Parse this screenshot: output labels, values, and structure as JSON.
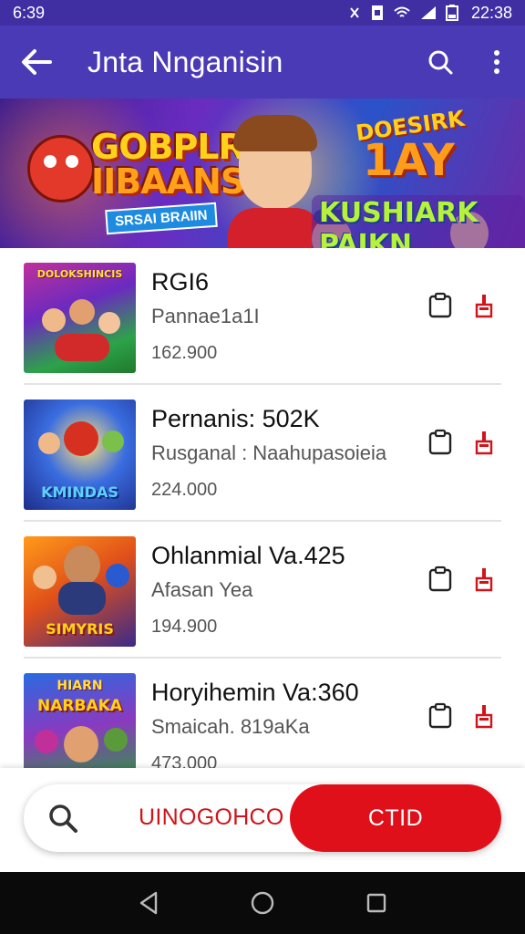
{
  "status_bar": {
    "time_left": "6:39",
    "time_right": "22:38"
  },
  "app_bar": {
    "title": "Jnta Nnganisin"
  },
  "banner": {
    "left_title_line1": "GOBPLR",
    "left_title_line2": "IIBAANSN",
    "left_subtitle": "SRSAI BRAIIN",
    "right_line1": "DOESIRK",
    "right_line2": "1AY",
    "right_line3": "KUSHIARK PAIKN"
  },
  "games": [
    {
      "name": "RGI6",
      "subtitle": "Pannae1a1I",
      "count": "162.900",
      "thumb_top": "DOLOKSHINCIS",
      "thumb_label": ""
    },
    {
      "name": "Pernanis: 502K",
      "subtitle": "Rusganal : Naahupasoieia",
      "count": "224.000",
      "thumb_top": "",
      "thumb_label": "KMINDAS"
    },
    {
      "name": "Ohlanmial Va.425",
      "subtitle": "Afasan Yea",
      "count": "194.900",
      "thumb_top": "",
      "thumb_label": "SIMYRIS"
    },
    {
      "name": "Horyihemin Va:360",
      "subtitle": "Smaicah. 819aKa",
      "count": "473.000",
      "thumb_top": "HIARN",
      "thumb_label": "NARBAKA"
    }
  ],
  "bottom": {
    "search_text": "UINOGOHCO",
    "cta_label": "CTID"
  },
  "colors": {
    "primary": "#4a3ab5",
    "status": "#3f2fa3",
    "accent": "#e0101a"
  },
  "icons": [
    "back-arrow-icon",
    "search-icon",
    "more-vert-icon",
    "clipboard-icon",
    "report-flag-icon",
    "nav-back-icon",
    "nav-home-icon",
    "nav-recents-icon"
  ]
}
